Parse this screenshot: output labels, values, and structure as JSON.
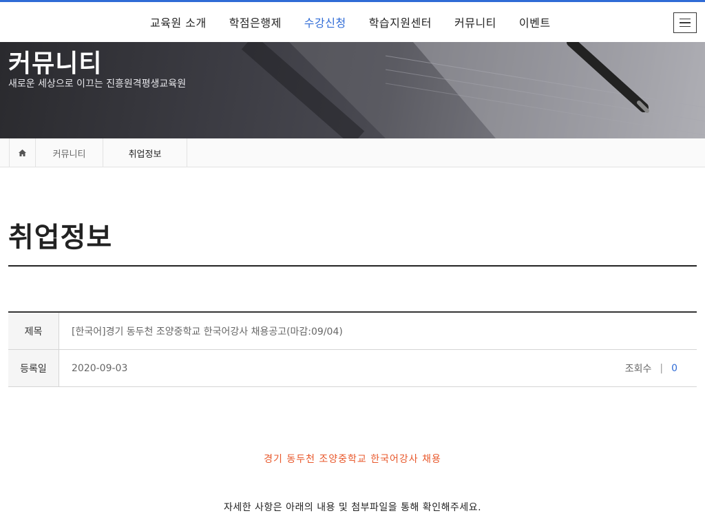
{
  "nav": {
    "items": [
      {
        "label": "교육원 소개",
        "active": false
      },
      {
        "label": "학점은행제",
        "active": false
      },
      {
        "label": "수강신청",
        "active": true
      },
      {
        "label": "학습지원센터",
        "active": false
      },
      {
        "label": "커뮤니티",
        "active": false
      },
      {
        "label": "이벤트",
        "active": false
      }
    ],
    "menu_icon": "hamburger-menu-icon"
  },
  "hero": {
    "title": "커뮤니티",
    "subtitle": "새로운 세상으로 이끄는 진흥원격평생교육원"
  },
  "breadcrumb": {
    "home_icon": "home-icon",
    "items": [
      "커뮤니티",
      "취업정보"
    ]
  },
  "page": {
    "title": "취업정보"
  },
  "post": {
    "subject_label": "제목",
    "subject": "[한국어]경기 동두천 조양중학교 한국어강사 채용공고(마감:09/04)",
    "date_label": "등록일",
    "date": "2020-09-03",
    "views_label": "조회수",
    "views_separator": "|",
    "views": "0"
  },
  "content": {
    "notice": "경기 동두천 조양중학교 한국어강사 채용",
    "detail": "자세한 사항은 아래의 내용 및 첨부파일을 통해 확인해주세요."
  },
  "colors": {
    "accent": "#2f6bd6",
    "notice": "#e8572a"
  }
}
